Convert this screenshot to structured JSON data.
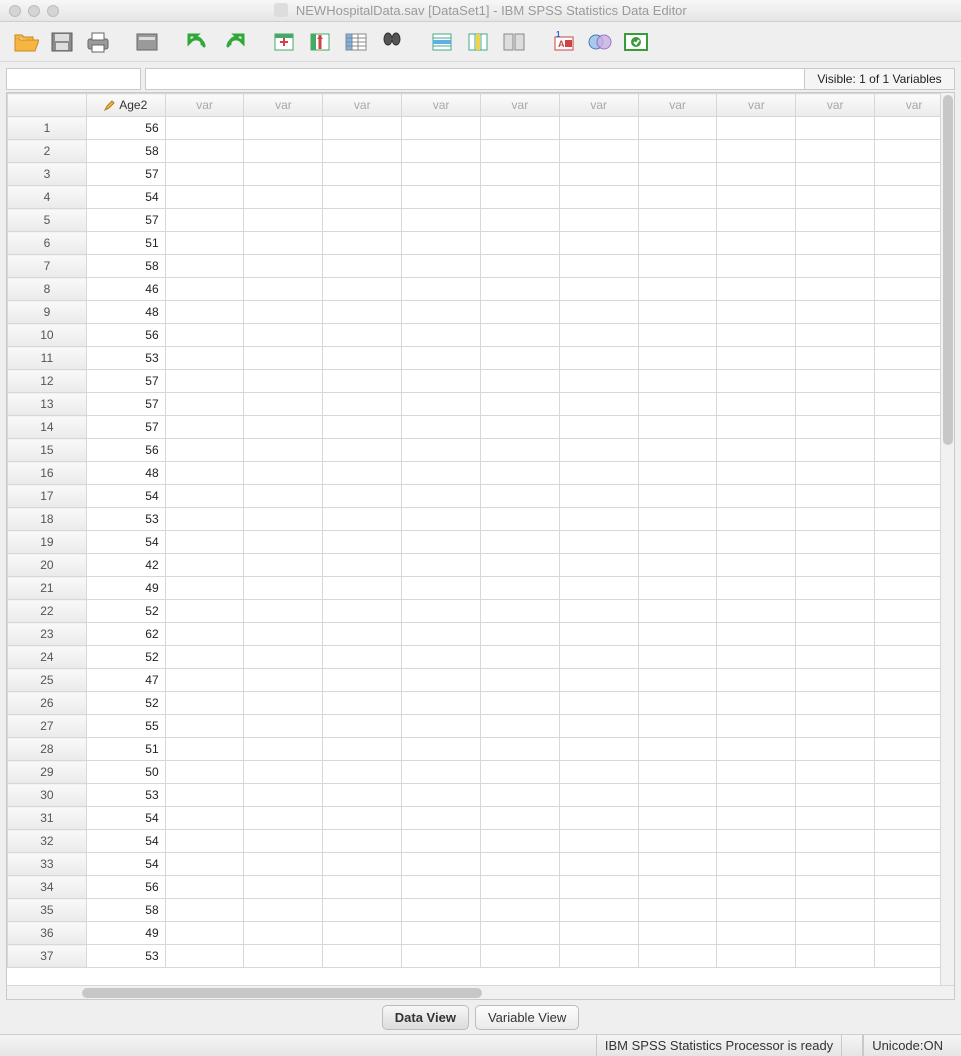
{
  "window": {
    "title": "NEWHospitalData.sav [DataSet1] - IBM SPSS Statistics Data Editor"
  },
  "toolbar": {
    "open": "Open",
    "save": "Save",
    "print": "Print",
    "recall": "Recall Dialog",
    "undo": "Undo",
    "redo": "Redo",
    "goto_case": "Go To Case",
    "goto_var": "Go To Variable",
    "variables": "Variables",
    "find": "Find",
    "insert_case": "Insert Case",
    "insert_var": "Insert Variable",
    "split": "Split File",
    "weight": "Weight Cases",
    "select": "Select Cases",
    "value_labels": "Value Labels",
    "use_sets": "Use Variable Sets",
    "addon": "Add-on"
  },
  "formula": {
    "namebox": "",
    "bar": "",
    "visible": "Visible: 1 of 1 Variables"
  },
  "grid": {
    "var_header": "Age2",
    "empty_header": "var",
    "col_count": 11,
    "rows": [
      {
        "n": 1,
        "v": 56
      },
      {
        "n": 2,
        "v": 58
      },
      {
        "n": 3,
        "v": 57
      },
      {
        "n": 4,
        "v": 54
      },
      {
        "n": 5,
        "v": 57
      },
      {
        "n": 6,
        "v": 51
      },
      {
        "n": 7,
        "v": 58
      },
      {
        "n": 8,
        "v": 46
      },
      {
        "n": 9,
        "v": 48
      },
      {
        "n": 10,
        "v": 56
      },
      {
        "n": 11,
        "v": 53
      },
      {
        "n": 12,
        "v": 57
      },
      {
        "n": 13,
        "v": 57
      },
      {
        "n": 14,
        "v": 57
      },
      {
        "n": 15,
        "v": 56
      },
      {
        "n": 16,
        "v": 48
      },
      {
        "n": 17,
        "v": 54
      },
      {
        "n": 18,
        "v": 53
      },
      {
        "n": 19,
        "v": 54
      },
      {
        "n": 20,
        "v": 42
      },
      {
        "n": 21,
        "v": 49
      },
      {
        "n": 22,
        "v": 52
      },
      {
        "n": 23,
        "v": 62
      },
      {
        "n": 24,
        "v": 52
      },
      {
        "n": 25,
        "v": 47
      },
      {
        "n": 26,
        "v": 52
      },
      {
        "n": 27,
        "v": 55
      },
      {
        "n": 28,
        "v": 51
      },
      {
        "n": 29,
        "v": 50
      },
      {
        "n": 30,
        "v": 53
      },
      {
        "n": 31,
        "v": 54
      },
      {
        "n": 32,
        "v": 54
      },
      {
        "n": 33,
        "v": 54
      },
      {
        "n": 34,
        "v": 56
      },
      {
        "n": 35,
        "v": 58
      },
      {
        "n": 36,
        "v": 49
      },
      {
        "n": 37,
        "v": 53
      }
    ]
  },
  "tabs": {
    "data_view": "Data View",
    "variable_view": "Variable View"
  },
  "status": {
    "processor": "IBM SPSS Statistics Processor is ready",
    "unicode": "Unicode:ON"
  }
}
